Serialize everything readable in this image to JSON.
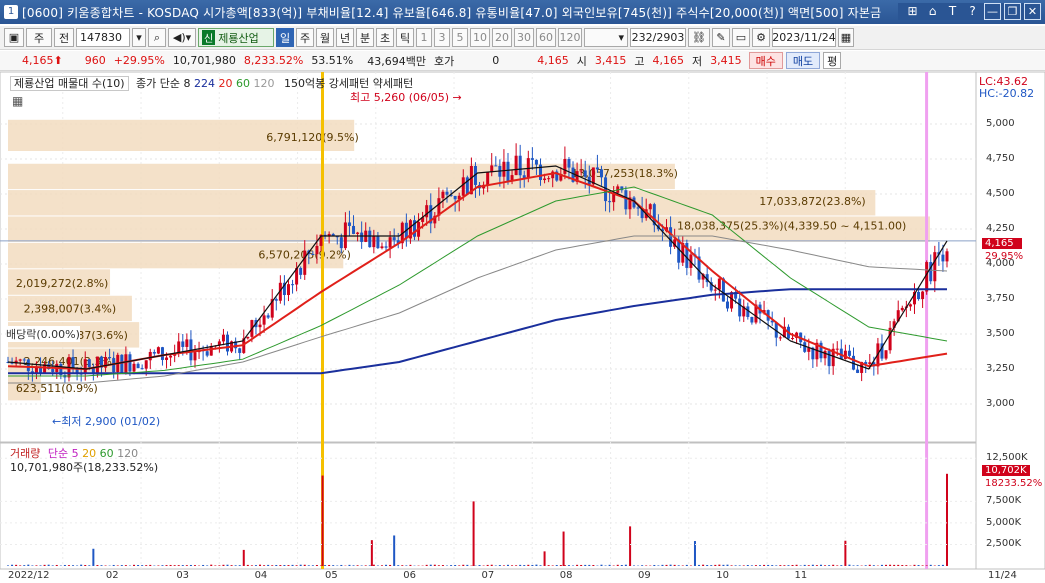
{
  "titlebar": {
    "number": "1",
    "title": "[0600] 키움종합차트 - KOSDAQ 시가총액[833(억)] 부채비율[12.4] 유보율[646.8] 유통비율[47.0] 외국인보유[745(천)] 주식수[20,000(천)] 액면[500] 자본금",
    "buttons": [
      "⊞",
      "⌂",
      "T",
      "?",
      "—",
      "❐",
      "✕"
    ]
  },
  "toolbar": {
    "period_label": "주",
    "prev_label": "전",
    "code": "147830",
    "stock_tag": "신",
    "stock_name": "제룡산업",
    "tabs": [
      "일",
      "주",
      "월",
      "년",
      "분",
      "초",
      "틱"
    ],
    "numbers": [
      "1",
      "3",
      "5",
      "10",
      "20",
      "30",
      "60",
      "120"
    ],
    "count": "232/2903",
    "date": "2023/11/24"
  },
  "quote": {
    "price": "4,165",
    "change": "960",
    "change_pct": "+29.95%",
    "volume": "10,701,980",
    "volume_pct": "8,233.52%",
    "ratio": "53.51%",
    "amount": "43,694백만",
    "hoga_label": "호가",
    "hoga_value": "0",
    "current": "4,165",
    "open_label": "시",
    "open": "3,415",
    "high_label": "고",
    "high": "4,165",
    "low_label": "저",
    "low": "3,415",
    "buy": "매수",
    "sell": "매도",
    "eval": "평"
  },
  "legend": {
    "name": "제룡산업 매물대 수(10)",
    "ma_label": "종가 단순 8",
    "ma_periods": [
      "224",
      "20",
      "60",
      "120"
    ],
    "pattern": "150억봉 강세패턴  약세패턴"
  },
  "price_axis": {
    "top_left": "LC:43.62",
    "top_right": "HC:-20.82",
    "ticks": [
      "5,000",
      "4,750",
      "4,500",
      "4,250",
      "4,000",
      "3,750",
      "3,500",
      "3,250",
      "3,000"
    ],
    "current_price": "4,165",
    "current_pct": "29.95%"
  },
  "annotations": {
    "high": "최고 5,260 (06/05) →",
    "low": "←최저 2,900 (01/02)",
    "partial": "배당락(0.00%)",
    "volume_profile": [
      "6,791,120(9.5%)",
      "6,570,205(9.2%)",
      "2,019,272(2.8%)",
      "2,398,007(3.4%)",
      "2,558,437(3.6%)",
      "2,246,401(3.3%)",
      "623,511(0.9%)",
      "13,057,253(18.3%)",
      "17,033,872(23.8%)",
      "18,038,375(25.3%)(4,339.50 ~ 4,151.00)"
    ]
  },
  "volume_pane": {
    "legend_name": "거래량",
    "legend_ma": [
      "단순 5",
      "20",
      "60",
      "120"
    ],
    "current": "10,701,980주(18,233.52%)",
    "ticks": [
      "12,500K",
      "7,500K",
      "5,000K",
      "2,500K"
    ],
    "current_label": "10,702K",
    "current_pct": "18233.52%"
  },
  "x_axis": [
    "2022/12",
    "02",
    "03",
    "04",
    "05",
    "06",
    "07",
    "08",
    "09",
    "10",
    "11",
    "11/24"
  ],
  "colors": {
    "up": "#d0021b",
    "down": "#1f57c4",
    "ma224": "#1a2f9c",
    "ma20": "#e0201a",
    "ma60": "#2e9a2e",
    "ma120": "#888888",
    "profile": "#f2dcc0"
  },
  "chart_data": {
    "type": "candlestick",
    "title": "제룡산업 매물대 수(10)",
    "x_range": [
      "2022/12",
      "2023/11/24"
    ],
    "ylim": [
      2900,
      5300
    ],
    "price": {
      "current": 4165,
      "high": 5260,
      "high_date": "06/05",
      "low": 2900,
      "low_date": "01/02"
    },
    "series": [
      {
        "name": "종가",
        "x": [
          "12",
          "01",
          "02",
          "03",
          "04",
          "05",
          "06",
          "07",
          "08",
          "09",
          "10",
          "11",
          "11/24"
        ],
        "values": [
          3300,
          3250,
          3350,
          3450,
          4200,
          4200,
          4650,
          4700,
          4450,
          3850,
          3450,
          3250,
          4165
        ]
      },
      {
        "name": "224",
        "x": [
          "12",
          "01",
          "02",
          "03",
          "04",
          "05",
          "06",
          "07",
          "08",
          "09",
          "10",
          "11",
          "11/24"
        ],
        "values": [
          3220,
          3220,
          3220,
          3220,
          3220,
          3300,
          3450,
          3600,
          3700,
          3780,
          3820,
          3820,
          3820
        ]
      },
      {
        "name": "20",
        "x": [
          "12",
          "01",
          "02",
          "03",
          "04",
          "05",
          "06",
          "07",
          "08",
          "09",
          "10",
          "11",
          "11/24"
        ],
        "values": [
          3270,
          3250,
          3350,
          3420,
          3800,
          4150,
          4550,
          4650,
          4450,
          3950,
          3500,
          3270,
          3360
        ]
      },
      {
        "name": "60",
        "x": [
          "12",
          "01",
          "02",
          "03",
          "04",
          "05",
          "06",
          "07",
          "08",
          "09",
          "10",
          "11",
          "11/24"
        ],
        "values": [
          3200,
          3200,
          3240,
          3320,
          3560,
          3850,
          4200,
          4450,
          4550,
          4350,
          3900,
          3550,
          3450
        ]
      },
      {
        "name": "120",
        "x": [
          "12",
          "01",
          "02",
          "03",
          "04",
          "05",
          "06",
          "07",
          "08",
          "09",
          "10",
          "11",
          "11/24"
        ],
        "values": [
          3150,
          3150,
          3200,
          3300,
          3480,
          3650,
          3900,
          4100,
          4200,
          4200,
          4100,
          3980,
          3950
        ]
      }
    ],
    "volume_profile": [
      {
        "range_low": 4800,
        "range_high": 5030,
        "volume": 6791120,
        "pct": 9.5
      },
      {
        "range_low": 4151,
        "range_high": 4339.5,
        "volume": 18038375,
        "pct": 25.3
      },
      {
        "range_low": 4339.5,
        "range_high": 4528,
        "volume": 17033872,
        "pct": 23.8
      },
      {
        "range_low": 4528,
        "range_high": 4716,
        "volume": 13057253,
        "pct": 18.3
      },
      {
        "range_low": 3962,
        "range_high": 4151,
        "volume": 6570205,
        "pct": 9.2
      },
      {
        "range_low": 3773,
        "range_high": 3962,
        "volume": 2019272,
        "pct": 2.8
      },
      {
        "range_low": 3585,
        "range_high": 3773,
        "volume": 2398007,
        "pct": 3.4
      },
      {
        "range_low": 3396,
        "range_high": 3585,
        "volume": 2558437,
        "pct": 3.6
      },
      {
        "range_low": 3208,
        "range_high": 3396,
        "volume": 2246401,
        "pct": 3.3
      },
      {
        "range_low": 3019,
        "range_high": 3208,
        "volume": 623511,
        "pct": 0.9
      }
    ],
    "volume": {
      "current": 10701980,
      "unit": "주",
      "ratio_pct": 18233.52
    }
  }
}
